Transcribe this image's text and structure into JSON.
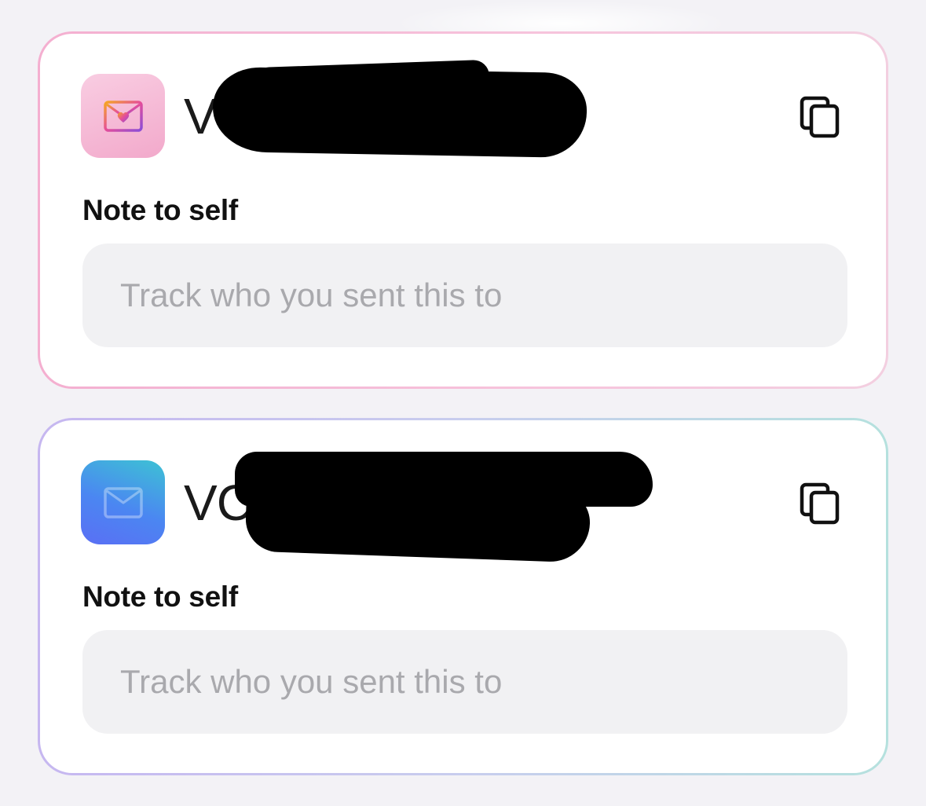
{
  "cards": [
    {
      "email_visible_prefix": "V",
      "app_icon": "envelope-heart-icon",
      "copy_icon": "copy-icon",
      "note_label": "Note to self",
      "note_placeholder": "Track who you sent this to",
      "note_value": ""
    },
    {
      "email_visible_prefix": "VC",
      "app_icon": "envelope-icon",
      "copy_icon": "copy-icon",
      "note_label": "Note to self",
      "note_placeholder": "Track who you sent this to",
      "note_value": ""
    }
  ],
  "colors": {
    "card1_border": "#f4afd0",
    "card2_border_start": "#c6b7f0",
    "card2_border_end": "#b5e1de",
    "card1_icon": "#f2a9cb",
    "card2_icon": "#4b86f2",
    "input_background": "#f1f1f3",
    "placeholder": "#a9a9ad"
  }
}
